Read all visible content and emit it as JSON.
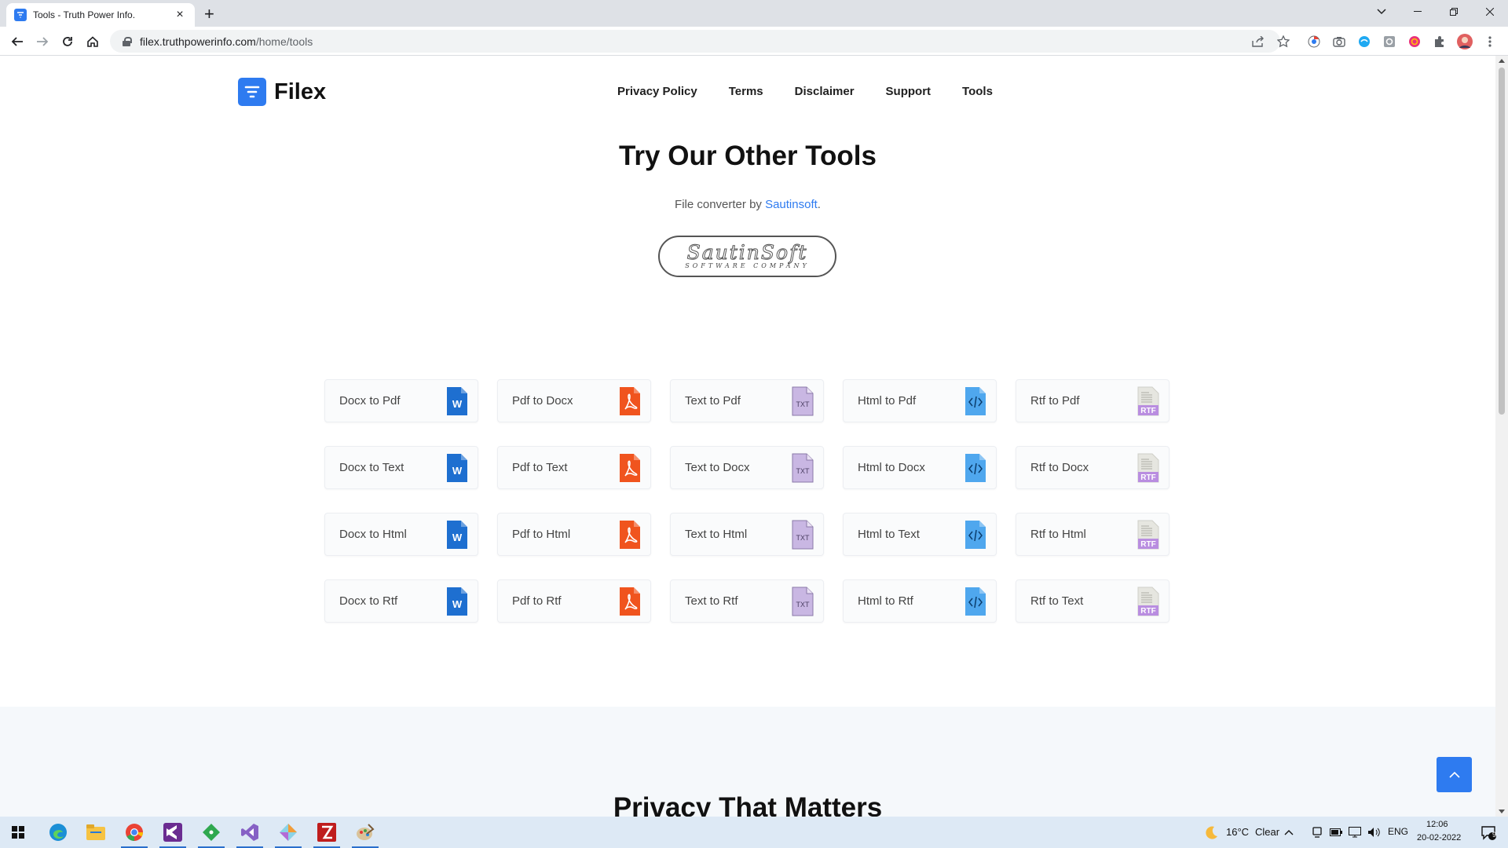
{
  "browser": {
    "tab_title": "Tools - Truth Power Info.",
    "url_domain": "filex.truthpowerinfo.com",
    "url_path": "/home/tools"
  },
  "site": {
    "logo_text": "Filex",
    "nav": [
      "Privacy Policy",
      "Terms",
      "Disclaimer",
      "Support",
      "Tools"
    ]
  },
  "hero": {
    "title": "Try Our Other Tools",
    "subtitle_prefix": "File converter by ",
    "subtitle_link": "Sautinsoft",
    "subtitle_suffix": ".",
    "badge_name": "SautinSoft",
    "badge_tagline": "SOFTWARE COMPANY"
  },
  "tools": [
    {
      "label": "Docx to Pdf",
      "icon": "word-icon"
    },
    {
      "label": "Pdf to Docx",
      "icon": "pdf-icon"
    },
    {
      "label": "Text to Pdf",
      "icon": "txt-icon"
    },
    {
      "label": "Html to Pdf",
      "icon": "html-icon"
    },
    {
      "label": "Rtf to Pdf",
      "icon": "rtf-icon"
    },
    {
      "label": "Docx to Text",
      "icon": "word-icon"
    },
    {
      "label": "Pdf to Text",
      "icon": "pdf-icon"
    },
    {
      "label": "Text to Docx",
      "icon": "txt-icon"
    },
    {
      "label": "Html to Docx",
      "icon": "html-icon"
    },
    {
      "label": "Rtf to Docx",
      "icon": "rtf-icon"
    },
    {
      "label": "Docx to Html",
      "icon": "word-icon"
    },
    {
      "label": "Pdf to Html",
      "icon": "pdf-icon"
    },
    {
      "label": "Text to Html",
      "icon": "txt-icon"
    },
    {
      "label": "Html to Text",
      "icon": "html-icon"
    },
    {
      "label": "Rtf to Html",
      "icon": "rtf-icon"
    },
    {
      "label": "Docx to Rtf",
      "icon": "word-icon"
    },
    {
      "label": "Pdf to Rtf",
      "icon": "pdf-icon"
    },
    {
      "label": "Text to Rtf",
      "icon": "txt-icon"
    },
    {
      "label": "Html to Rtf",
      "icon": "html-icon"
    },
    {
      "label": "Rtf to Text",
      "icon": "rtf-icon"
    }
  ],
  "section2": {
    "title": "Privacy That Matters"
  },
  "taskbar": {
    "weather_temp": "16°C",
    "weather_desc": "Clear",
    "language": "ENG",
    "time": "12:06",
    "date": "20-02-2022",
    "notification_count": "9"
  },
  "colors": {
    "brand": "#2e7bf0",
    "word": "#1e6fd0",
    "pdf": "#f0541e",
    "txt": "#c9b7e3",
    "html": "#4fa7ee",
    "rtf": "#b98de0"
  }
}
